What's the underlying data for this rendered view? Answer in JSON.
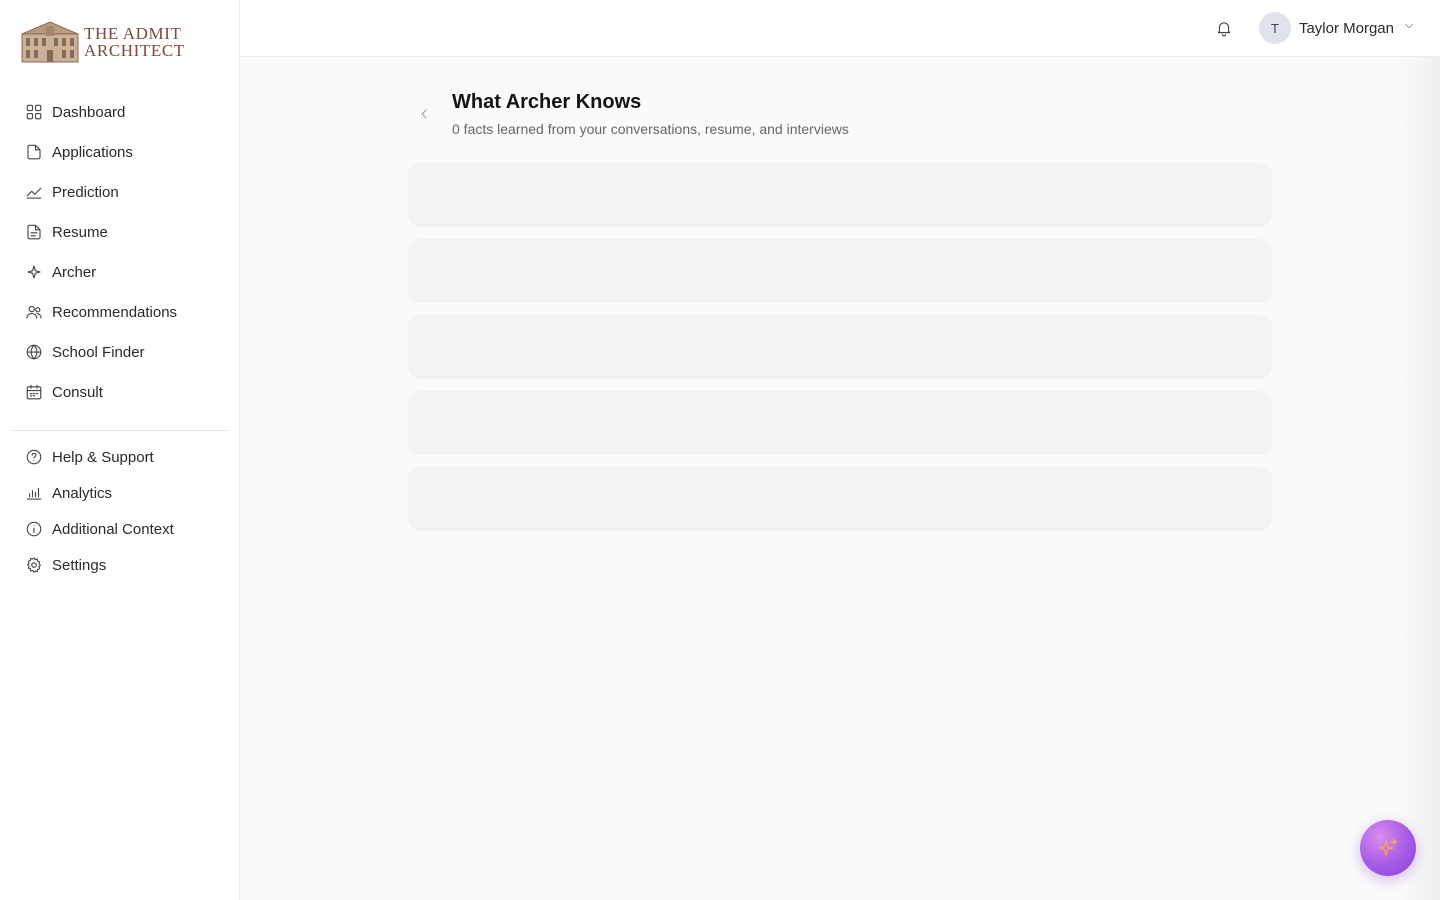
{
  "brand": {
    "line1": "The Admit",
    "line2": "Architect"
  },
  "sidebar": {
    "items": [
      {
        "label": "Dashboard",
        "icon": "grid-icon"
      },
      {
        "label": "Applications",
        "icon": "file-icon"
      },
      {
        "label": "Prediction",
        "icon": "trend-icon"
      },
      {
        "label": "Resume",
        "icon": "document-icon"
      },
      {
        "label": "Archer",
        "icon": "sparkle-icon"
      },
      {
        "label": "Recommendations",
        "icon": "users-icon"
      },
      {
        "label": "School Finder",
        "icon": "globe-icon"
      },
      {
        "label": "Consult",
        "icon": "calendar-icon"
      }
    ],
    "secondary": [
      {
        "label": "Help & Support",
        "icon": "help-circle-icon"
      },
      {
        "label": "Analytics",
        "icon": "bar-chart-icon"
      },
      {
        "label": "Additional Context",
        "icon": "info-icon"
      },
      {
        "label": "Settings",
        "icon": "gear-icon"
      }
    ]
  },
  "header": {
    "user": {
      "initial": "T",
      "name": "Taylor Morgan"
    }
  },
  "main": {
    "title": "What Archer Knows",
    "subtitle": "0 facts learned from your conversations, resume, and interviews"
  },
  "colors": {
    "accent_fab": "#a55ae6",
    "brand_text": "#7a4a3a",
    "skeleton": "#f3f3f3"
  }
}
